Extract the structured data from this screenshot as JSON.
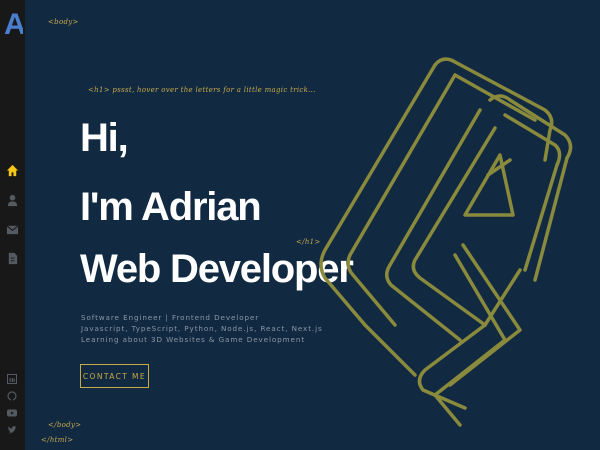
{
  "sidebar": {
    "logo_letter": "A",
    "nav": [
      {
        "icon": "home-icon",
        "active": true
      },
      {
        "icon": "user-icon",
        "active": false
      },
      {
        "icon": "mail-icon",
        "active": false
      },
      {
        "icon": "document-icon",
        "active": false
      }
    ],
    "social": [
      "linkedin-icon",
      "github-icon",
      "youtube-icon",
      "twitter-icon"
    ]
  },
  "tags": {
    "body_open": "<body>",
    "h1_open": "<h1> pssst, hover over the letters for a little magic trick...",
    "h1_close": "</h1>",
    "body_close": "</body>",
    "html_close": "</html>"
  },
  "hero": {
    "line1": "Hi,",
    "line2": "I'm Adrian",
    "line3": "Web Developer"
  },
  "description": {
    "line1": "Software Engineer | Frontend Developer",
    "line2": "Javascript, TypeScript, Python, Node.js, React, Next.js",
    "line3": "Learning about 3D Websites & Game Development"
  },
  "cta": {
    "label": "CONTACT ME"
  },
  "colors": {
    "background": "#112a42",
    "sidebar": "#181818",
    "accent": "#c8a94a",
    "logo": "#4a7fd0",
    "active_nav": "#f5c518",
    "icon": "#555a60"
  }
}
